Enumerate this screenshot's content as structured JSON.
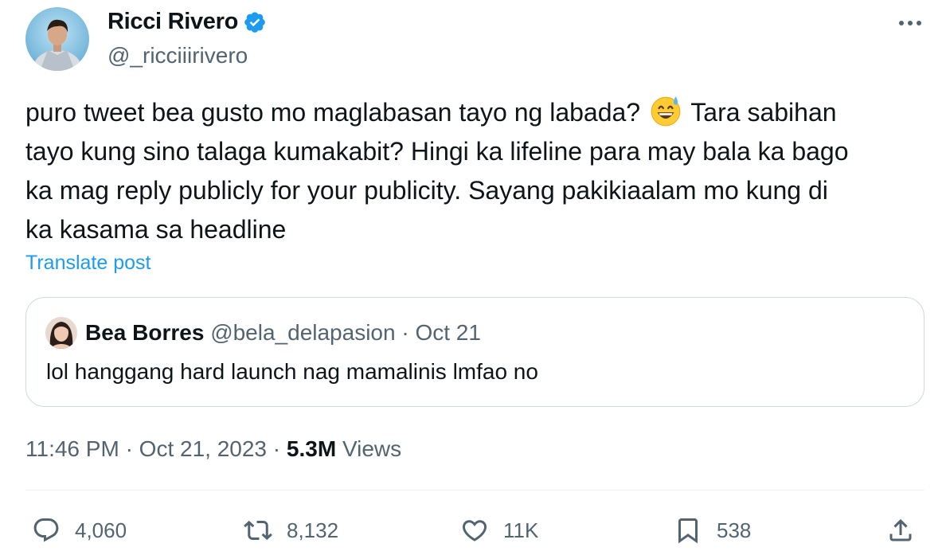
{
  "author": {
    "name": "Ricci Rivero",
    "handle": "@_ricciiirivero"
  },
  "post": {
    "lines": [
      "puro tweet bea gusto mo maglabasan tayo ng labada?",
      "Tara sabihan",
      "tayo kung sino talaga kumakabit? Hingi ka lifeline para may bala ka bago",
      "ka mag reply publicly for your publicity. Sayang pakikiaalam mo kung di",
      "ka kasama sa headline"
    ],
    "emoji": "grinning-face-with-sweat",
    "translate_label": "Translate post"
  },
  "quote": {
    "name": "Bea Borres",
    "handle": "@bela_delapasion",
    "separator": "·",
    "date": "Oct 21",
    "text": "lol hanggang hard launch nag mamalinis lmfao no"
  },
  "meta": {
    "time": "11:46 PM",
    "separator": "·",
    "date": "Oct 21, 2023",
    "views_count": "5.3M",
    "views_label": "Views"
  },
  "actions": {
    "replies": "4,060",
    "reposts": "8,132",
    "likes": "11K",
    "bookmarks": "538"
  },
  "colors": {
    "accent": "#1d9bf0",
    "text": "#0f1419",
    "secondary": "#536471",
    "border": "#cfd9de"
  }
}
